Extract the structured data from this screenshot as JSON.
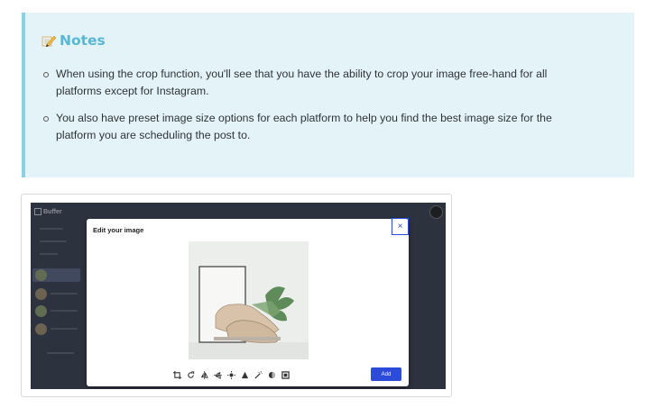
{
  "notes": {
    "title": "Notes",
    "items": [
      "When using the crop function, you'll see that you have the ability to crop your image free-hand for all platforms except for Instagram.",
      "You also have preset image size options for each platform to help you find the best image size for the platform you are scheduling the post to."
    ]
  },
  "screenshot": {
    "brand": "Buffer",
    "modal": {
      "title": "Edit your image",
      "close_label": "×",
      "add_label": "Add"
    },
    "toolbar_icons": [
      "crop-icon",
      "rotate-icon",
      "flip-horizontal-icon",
      "flip-vertical-icon",
      "brightness-icon",
      "contrast-icon",
      "magic-wand-icon",
      "saturation-icon",
      "frame-icon"
    ]
  }
}
